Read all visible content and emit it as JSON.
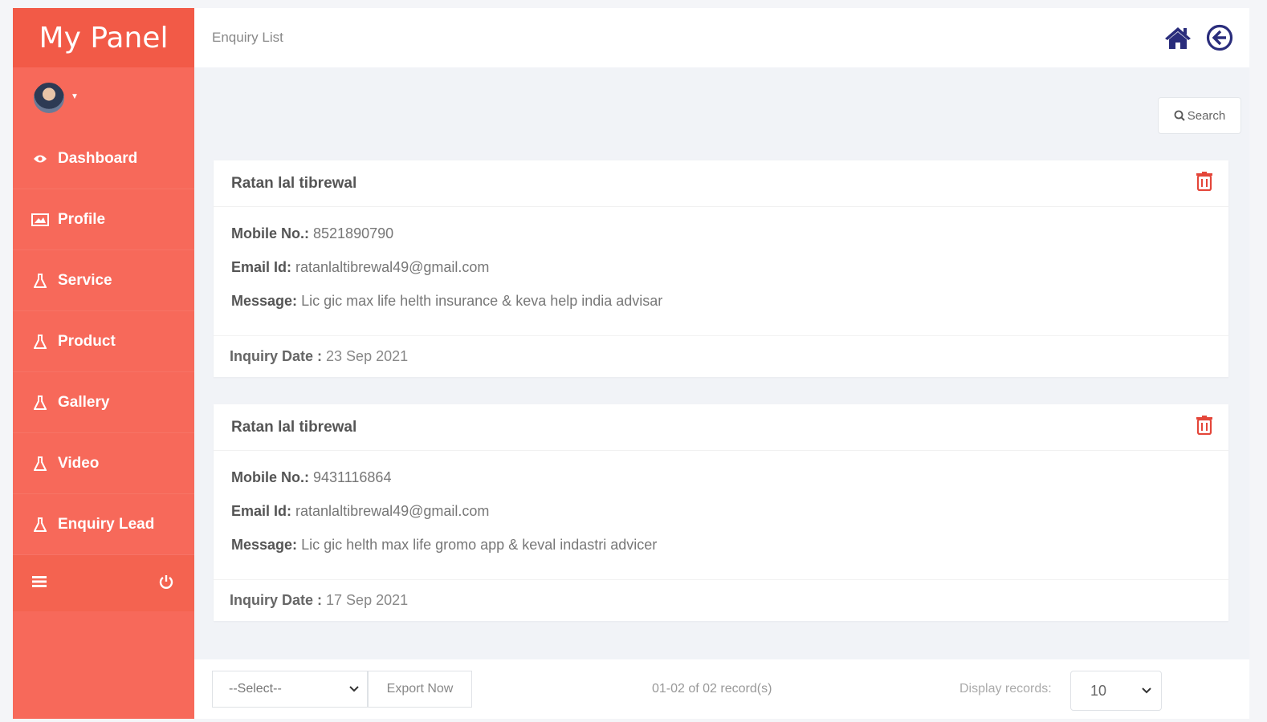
{
  "sidebar": {
    "brand": "My Panel",
    "items": [
      {
        "label": "Dashboard",
        "icon": "eye-icon"
      },
      {
        "label": "Profile",
        "icon": "image-icon"
      },
      {
        "label": "Service",
        "icon": "flask-icon"
      },
      {
        "label": "Product",
        "icon": "flask-icon"
      },
      {
        "label": "Gallery",
        "icon": "flask-icon"
      },
      {
        "label": "Video",
        "icon": "flask-icon"
      },
      {
        "label": "Enquiry Lead",
        "icon": "flask-icon"
      }
    ],
    "footer": {
      "menu_icon": "hamburger-icon",
      "power_icon": "power-icon"
    }
  },
  "header": {
    "title": "Enquiry List",
    "icons": [
      "home-icon",
      "back-arrow-icon"
    ]
  },
  "search_button": "Search",
  "labels": {
    "mobile": "Mobile No.:",
    "email": "Email Id:",
    "message": "Message:",
    "date": "Inquiry Date :"
  },
  "enquiries": [
    {
      "name": "Ratan lal tibrewal",
      "mobile": "8521890790",
      "email": "ratanlaltibrewal49@gmail.com",
      "message": "Lic gic max life helth insurance & keva help india advisar",
      "date": "23 Sep 2021"
    },
    {
      "name": "Ratan lal tibrewal",
      "mobile": "9431116864",
      "email": "ratanlaltibrewal49@gmail.com",
      "message": "Lic gic helth max life gromo app & keval indastri advicer",
      "date": "17 Sep 2021"
    }
  ],
  "footer": {
    "select_value": "--Select--",
    "export_label": "Export Now",
    "records_info": "01-02 of 02 record(s)",
    "display_label": "Display records:",
    "display_value": "10"
  },
  "colors": {
    "sidebar": "#f7695a",
    "brand": "#f25a47",
    "header_icons": "#2a2d7c",
    "delete_icon": "#e4463a"
  }
}
